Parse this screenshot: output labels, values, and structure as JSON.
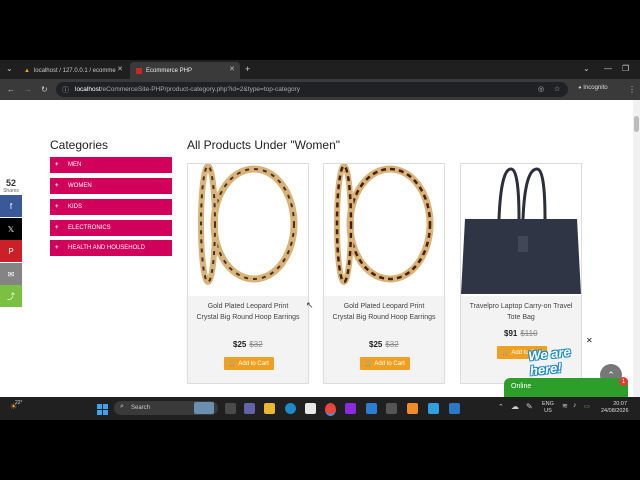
{
  "browser": {
    "tabs": [
      {
        "label": "localhost / 127.0.0.1 / ecomme"
      },
      {
        "label": "Ecommerce PHP"
      }
    ],
    "new_tab": "+",
    "window_controls": [
      "⌄",
      "—",
      "❐",
      "✕"
    ],
    "url_host": "localhost",
    "url_path": "/eCommerceSite-PHP/product-category.php?id=2&type=top-category",
    "profile": "Incognito"
  },
  "sidebar": {
    "title": "Categories",
    "items": [
      {
        "label": "MEN"
      },
      {
        "label": "WOMEN"
      },
      {
        "label": "KIDS"
      },
      {
        "label": "ELECTRONICS"
      },
      {
        "label": "HEALTH AND HOUSEHOLD"
      }
    ]
  },
  "main": {
    "heading": "All Products Under \"Women\"",
    "products": [
      {
        "name": "Gold Plated Leopard Print Crystal Big Round Hoop Earrings",
        "price": "$25",
        "old_price": "$32",
        "cart_label": "Add to Cart",
        "image_icon": "hoop-earring-icon"
      },
      {
        "name": "Gold Plated Leopard Print Crystal Big Round Hoop Earrings",
        "price": "$25",
        "old_price": "$32",
        "cart_label": "Add to Cart",
        "image_icon": "hoop-earring-icon"
      },
      {
        "name": "Travelpro Laptop Carry-on Travel Tote Bag",
        "price": "$91",
        "old_price": "$110",
        "cart_label": "Add to Cart",
        "image_icon": "tote-bag-icon"
      }
    ]
  },
  "share_bar": {
    "count": "52",
    "count_label": "Shares",
    "buttons": [
      {
        "icon": "facebook-icon",
        "glyph": "f",
        "color": "#3b5998"
      },
      {
        "icon": "x-icon",
        "glyph": "𝕏",
        "color": "#000000"
      },
      {
        "icon": "pinterest-icon",
        "glyph": "P",
        "color": "#cb2027"
      },
      {
        "icon": "email-icon",
        "glyph": "✉",
        "color": "#848484"
      },
      {
        "icon": "share-icon",
        "glyph": "⤴",
        "color": "#7bc043"
      }
    ]
  },
  "chat": {
    "banner": "We are here!",
    "status": "Online",
    "badge": "1"
  },
  "taskbar": {
    "weather": "22°",
    "search": "Search",
    "lang": "ENG",
    "region": "US",
    "time": "20:07",
    "date": "24/08/2026"
  },
  "colors": {
    "category": "#d1005b",
    "cart": "#f0a020",
    "chat": "#2e9e2a"
  }
}
